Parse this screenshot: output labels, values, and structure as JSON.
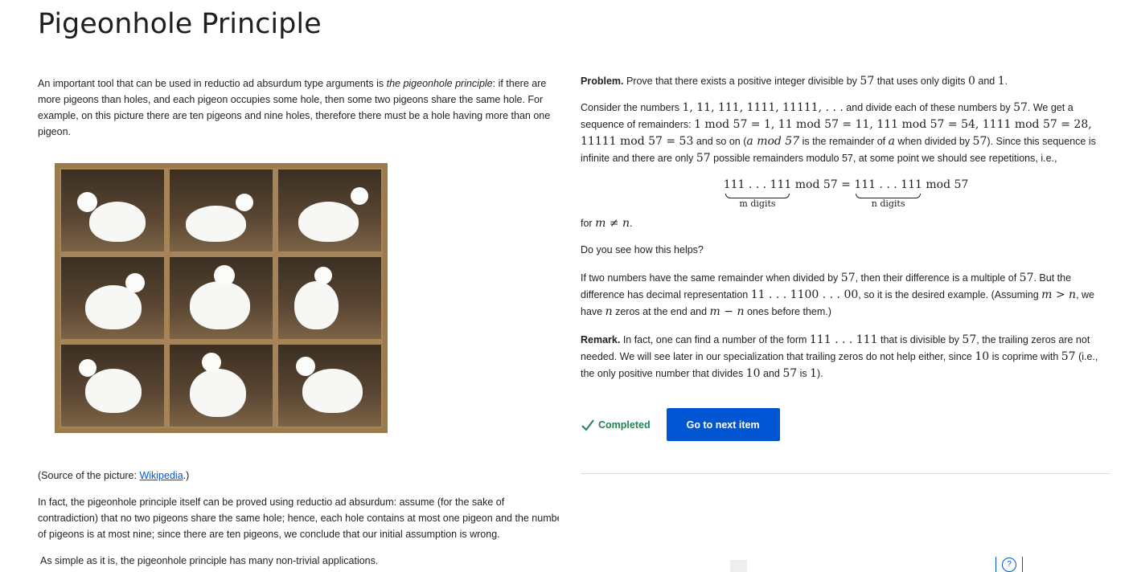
{
  "title": "Pigeonhole Principle",
  "left": {
    "intro_a": "An important tool that can be used in reductio ad absurdum type arguments is ",
    "intro_em": "the pigeonhole principle",
    "intro_b": ": if there are more pigeons than holes, and each pigeon occupies some hole, then some two pigeons share the same hole. For example, on this picture there are ten pigeons and nine holes, therefore there must be a hole having more than one pigeon.",
    "caption_a": "(Source of the picture: ",
    "caption_link": "Wikipedia",
    "caption_b": ".)",
    "para2_line1": "In fact, the pigeonhole principle itself can be proved using reductio ad absurdum: assume (for the sake of",
    "para2_line2": "contradiction) that no two pigeons share the same hole; hence, each hole contains at most one pigeon and the numbe",
    "para2_line3": "of pigeons is at most nine; since there are ten pigeons, we conclude that our initial assumption is wrong.",
    "para3": "As simple as it is, the pigeonhole principle has many non-trivial applications."
  },
  "right": {
    "problem_label": "Problem.",
    "problem_a": " Prove that there exists a positive integer divisible by ",
    "n57": "57",
    "problem_b": " that uses only digits ",
    "d0": "0",
    "and": " and ",
    "d1": "1",
    "dot": ".",
    "consider_a": "Consider the numbers ",
    "seq": "1, 11, 111, 1111, 11111, . . .",
    "consider_b": " and divide each of these numbers by ",
    "consider_c": ". We get a sequence of remainders: ",
    "rem1": "1 mod 57 = 1, 11 mod 57 = 11, 111 mod 57 = 54, 1111 mod 57 = 28,",
    "rem2": "11111 mod 57 = 53",
    "consider_d": " and so on (",
    "amod": "a mod 57",
    "consider_e": " is the remainder of ",
    "a": "a",
    "consider_f": " when divided by ",
    "consider_g": "). Since this sequence is infinite and there are only ",
    "consider_h": " possible remainders modulo 57, at some point we should see repetitions, i.e.,",
    "eq_left": "111 . . . 111",
    "eq_mod": " mod 57 = ",
    "eq_right": "111 . . . 111",
    "eq_mod2": " mod 57",
    "sub_m": "m digits",
    "sub_n": "n digits",
    "for_text": "for ",
    "m_neq_n": "m ≠ n",
    "do_you": "Do you see how this helps?",
    "if_a": "If two numbers have the same remainder when divided by ",
    "if_b": ", then their difference is a multiple of ",
    "if_c": ". But the difference has decimal representation ",
    "diffrep": "11 . . . 1100 . . . 00",
    "if_d": ", so it is the desired example. (Assuming ",
    "m_gt_n": "m > n",
    "if_e": ", we have ",
    "n": "n",
    "if_f": " zeros at the end and ",
    "m_minus_n": "m − n",
    "if_g": " ones before them.)",
    "remark_label": "Remark.",
    "remark_a": " In fact, one can find a number of the form ",
    "form": "111 . . . 111",
    "remark_b": " that is divisible by ",
    "remark_c": ", the trailing zeros are not needed. We will see later in our specialization that trailing zeros do not help either, since ",
    "n10": "10",
    "remark_d": " is coprime with ",
    "remark_e": " (i.e., the only positive number that divides ",
    "remark_f": " and ",
    "remark_g": " is ",
    "remark_h": ")."
  },
  "actions": {
    "completed_label": "Completed",
    "next_label": "Go to next item"
  },
  "help_icon_glyph": "?",
  "icons": [
    "check-icon",
    "help-icon"
  ],
  "colors": {
    "accent": "#0056d2",
    "completed": "#1f8354"
  }
}
